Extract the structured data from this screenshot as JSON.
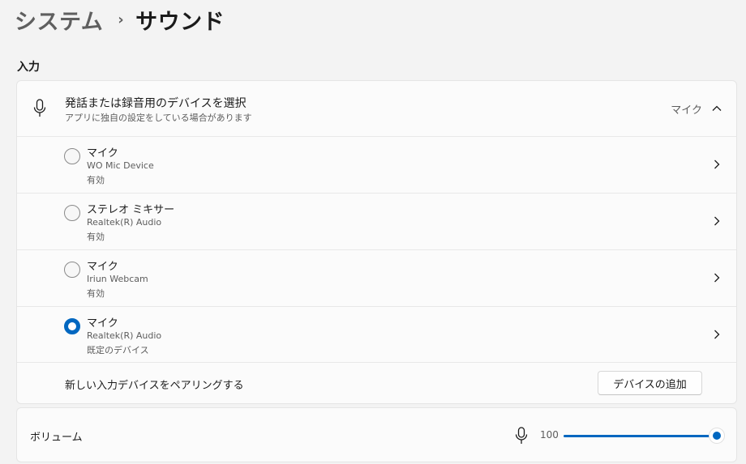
{
  "breadcrumb": {
    "parent": "システム",
    "separator": "›",
    "current": "サウンド"
  },
  "input_section": {
    "title": "入力",
    "select_device": {
      "title": "発話または録音用のデバイスを選択",
      "subtitle": "アプリに独自の設定をしている場合があります",
      "selected_value": "マイク",
      "expanded": true
    },
    "devices": [
      {
        "name": "マイク",
        "detail": "WO Mic Device",
        "status": "有効",
        "selected": false
      },
      {
        "name": "ステレオ ミキサー",
        "detail": "Realtek(R) Audio",
        "status": "有効",
        "selected": false
      },
      {
        "name": "マイク",
        "detail": "Iriun Webcam",
        "status": "有効",
        "selected": false
      },
      {
        "name": "マイク",
        "detail": "Realtek(R) Audio",
        "status": "既定のデバイス",
        "selected": true
      }
    ],
    "pair": {
      "label": "新しい入力デバイスをペアリングする",
      "button_label": "デバイスの追加"
    }
  },
  "volume": {
    "label": "ボリューム",
    "value": "100",
    "level_percent": 100
  },
  "colors": {
    "accent": "#0067c0",
    "background": "#f3f3f3",
    "card": "#fbfbfb"
  },
  "icons": {
    "header_mic": "microphone-icon",
    "volume_mic": "microphone-icon",
    "collapse": "chevron-up-icon",
    "row_chevron": "chevron-right-icon"
  }
}
